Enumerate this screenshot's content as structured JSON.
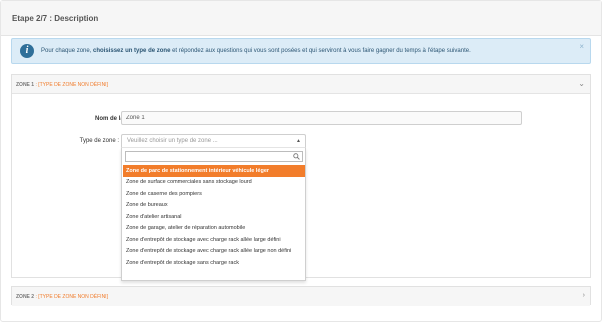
{
  "step": {
    "title": "Etape 2/7 : Description"
  },
  "info": {
    "icon": "info-circle-icon",
    "text_before": "Pour chaque zone, ",
    "text_bold": "choisissez un type de zone",
    "text_after": " et répondez aux questions qui vous sont posées et qui serviront à vous faire gagner du temps à l'étape suivante.",
    "close": "×"
  },
  "zone1": {
    "number": "ZONE 1",
    "type": " : [TYPE DE ZONE NON DÉFINI]",
    "chevron": "⌄",
    "name_label": "Nom de la zone",
    "name_value": "Zone 1",
    "type_label": "Type de zone :",
    "select_placeholder": "Veuillez choisir un type de zone ...",
    "select_arrow": "▲",
    "search_value": "",
    "options": [
      "Zone de parc de stationnement intérieur véhicule léger",
      "Zone de surface commerciales sans stockage lourd",
      "Zone de caserne des pompiers",
      "Zone de bureaux",
      "Zone d'atelier artisanal",
      "Zone de garage, atelier de réparation automobile",
      "Zone d'entrepôt de stockage avec charge rack allée large défini",
      "Zone d'entrepôt de stockage avec charge rack allée large non défini",
      "Zone d'entrepôt de stockage sans charge rack"
    ]
  },
  "zone2": {
    "number": "ZONE 2",
    "type": " : [TYPE DE ZONE NON DÉFINI]",
    "chevron": "›"
  },
  "colors": {
    "accent": "#f27d2b",
    "info_bg": "#dcecf7",
    "info_text": "#2c5674"
  }
}
